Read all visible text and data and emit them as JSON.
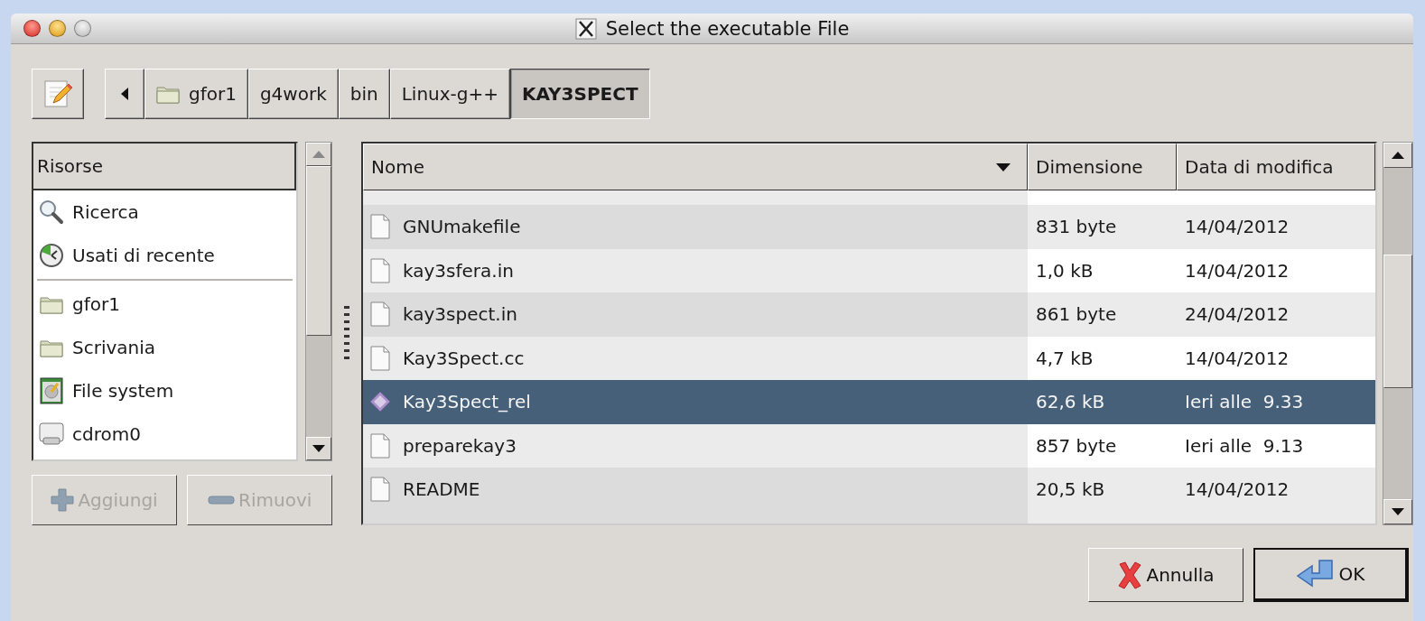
{
  "window": {
    "title": "Select the executable File"
  },
  "path_bar": {
    "segments": [
      {
        "label": "gfor1",
        "kind": "folder",
        "selected": false
      },
      {
        "label": "g4work",
        "kind": "plain",
        "selected": false
      },
      {
        "label": "bin",
        "kind": "plain",
        "selected": false
      },
      {
        "label": "Linux-g++",
        "kind": "plain",
        "selected": false
      },
      {
        "label": "KAY3SPECT",
        "kind": "plain",
        "selected": true
      }
    ]
  },
  "places": {
    "header": "Risorse",
    "shortcuts": [
      {
        "label": "Ricerca",
        "kind": "search"
      },
      {
        "label": "Usati di recente",
        "kind": "recent"
      }
    ],
    "bookmarks": [
      {
        "label": "gfor1",
        "kind": "folder"
      },
      {
        "label": "Scrivania",
        "kind": "folder"
      },
      {
        "label": "File system",
        "kind": "drive"
      },
      {
        "label": "cdrom0",
        "kind": "cdrom"
      }
    ],
    "buttons": [
      {
        "label": "Aggiungi",
        "kind": "add",
        "disabled": true
      },
      {
        "label": "Rimuovi",
        "kind": "remove",
        "disabled": true
      }
    ]
  },
  "files": {
    "columns": [
      {
        "label": "Nome",
        "sorted": true
      },
      {
        "label": "Dimensione",
        "sorted": false
      },
      {
        "label": "Data di modifica",
        "sorted": false
      }
    ],
    "rows": [
      {
        "name": "GNUmakefile",
        "size": "831 byte",
        "modified": "14/04/2012",
        "kind": "document",
        "selected": false
      },
      {
        "name": "kay3sfera.in",
        "size": "1,0 kB",
        "modified": "14/04/2012",
        "kind": "document",
        "selected": false
      },
      {
        "name": "kay3spect.in",
        "size": "861 byte",
        "modified": "24/04/2012",
        "kind": "document",
        "selected": false
      },
      {
        "name": "Kay3Spect.cc",
        "size": "4,7 kB",
        "modified": "14/04/2012",
        "kind": "document",
        "selected": false
      },
      {
        "name": "Kay3Spect_rel",
        "size": "62,6 kB",
        "modified": "Ieri alle  9.33",
        "kind": "executable",
        "selected": true
      },
      {
        "name": "preparekay3",
        "size": "857 byte",
        "modified": "Ieri alle  9.13",
        "kind": "document",
        "selected": false
      },
      {
        "name": "README",
        "size": "20,5 kB",
        "modified": "14/04/2012",
        "kind": "document",
        "selected": false
      }
    ]
  },
  "buttons": [
    {
      "label": "Annulla",
      "kind": "cancel",
      "default": false
    },
    {
      "label": "OK",
      "kind": "ok",
      "default": true
    }
  ]
}
